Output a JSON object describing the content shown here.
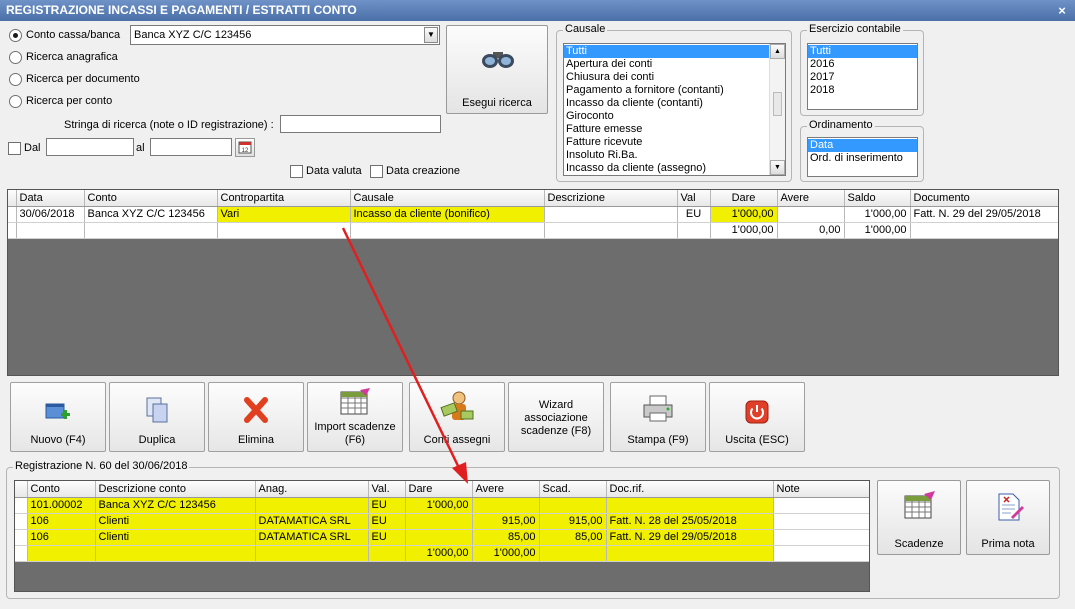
{
  "window": {
    "title": "REGISTRAZIONE INCASSI E PAGAMENTI / ESTRATTI CONTO",
    "close": "×"
  },
  "search": {
    "radio_conto": "Conto cassa/banca",
    "radio_anagrafica": "Ricerca anagrafica",
    "radio_documento": "Ricerca per documento",
    "radio_conto2": "Ricerca per conto",
    "selected_account": "Banca XYZ C/C 123456",
    "string_label": "Stringa di ricerca (note o ID registrazione) :",
    "string_value": "",
    "dal_label": "Dal",
    "al_label": "al",
    "data_valuta": "Data valuta",
    "data_creazione": "Data creazione",
    "search_button": "Esegui ricerca"
  },
  "causale": {
    "label": "Causale",
    "items": [
      "Tutti",
      "Apertura dei conti",
      "Chiusura dei conti",
      "Pagamento a fornitore (contanti)",
      "Incasso da cliente (contanti)",
      "Giroconto",
      "Fatture emesse",
      "Fatture ricevute",
      "Insoluto Ri.Ba.",
      "Incasso da cliente (assegno)"
    ]
  },
  "esercizio": {
    "label": "Esercizio contabile",
    "items": [
      "Tutti",
      "2016",
      "2017",
      "2018"
    ]
  },
  "ordinamento": {
    "label": "Ordinamento",
    "items": [
      "Data",
      "Ord. di inserimento"
    ]
  },
  "main_grid": {
    "headers": [
      "Data",
      "Conto",
      "Contropartita",
      "Causale",
      "Descrizione",
      "Val",
      "Dare",
      "Avere",
      "Saldo",
      "Documento"
    ],
    "row": [
      "30/06/2018",
      "Banca XYZ C/C 123456",
      "Vari",
      "Incasso da cliente (bonifico)",
      "",
      "EU",
      "1'000,00",
      "",
      "1'000,00",
      "Fatt. N. 29 del 29/05/2018"
    ],
    "totals": {
      "dare": "1'000,00",
      "avere": "0,00",
      "saldo": "1'000,00"
    }
  },
  "toolbar": {
    "nuovo": "Nuovo (F4)",
    "duplica": "Duplica",
    "elimina": "Elimina",
    "import_1": "Import scadenze",
    "import_2": "(F6)",
    "conti_assegni": "Conti assegni",
    "wizard_1": "Wizard",
    "wizard_2": "associazione",
    "wizard_3": "scadenze (F8)",
    "stampa": "Stampa (F9)",
    "uscita": "Uscita (ESC)"
  },
  "registration": {
    "label": "Registrazione N. 60 del 30/06/2018",
    "headers": [
      "Conto",
      "Descrizione conto",
      "Anag.",
      "Val.",
      "Dare",
      "Avere",
      "Scad.",
      "Doc.rif.",
      "Note"
    ],
    "rows": [
      [
        "101.00002",
        "Banca XYZ C/C 123456",
        "",
        "EU",
        "1'000,00",
        "",
        "",
        "",
        ""
      ],
      [
        "106",
        "Clienti",
        "DATAMATICA SRL",
        "EU",
        "",
        "915,00",
        "915,00",
        "Fatt. N. 28 del 25/05/2018",
        ""
      ],
      [
        "106",
        "Clienti",
        "DATAMATICA SRL",
        "EU",
        "",
        "85,00",
        "85,00",
        "Fatt. N. 29 del 29/05/2018",
        ""
      ]
    ],
    "totals": {
      "dare": "1'000,00",
      "avere": "1'000,00"
    },
    "scadenze_button": "Scadenze",
    "prima_nota_button": "Prima nota"
  },
  "colors": {
    "title_bar": "#4a6fa8",
    "highlight": "#f0f000",
    "selection": "#3399ff",
    "grid_bg": "#6d6d6d",
    "arrow": "#e02020"
  }
}
